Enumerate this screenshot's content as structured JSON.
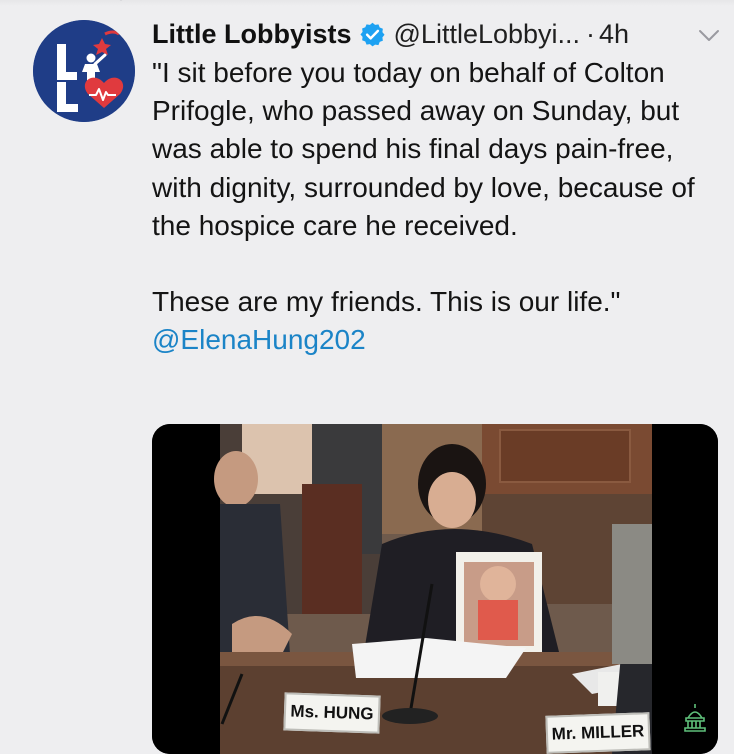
{
  "tweet": {
    "author_name": "Little Lobbyists",
    "handle": "@LittleLobbyi...",
    "separator": "·",
    "time": "4h",
    "avatar_icon": "little-lobbyists-logo-icon",
    "verified_icon": "verified-badge-icon",
    "menu_icon": "chevron-down-icon",
    "text_paragraph_1": "\"I sit before you today on behalf of Colton Prifogle, who passed away on Sunday, but was able to spend his final days pain-free, with dignity, surrounded by love, because of the hospice care he received.",
    "text_paragraph_2": "These are my friends. This is our life.\"",
    "mention": "@ElenaHung202"
  },
  "media": {
    "nameplate_left": "Ms. HUNG",
    "nameplate_right": "Mr. MILLER",
    "watermark_icon": "capitol-dome-icon"
  },
  "colors": {
    "background": "#eeeef0",
    "link": "#1b84c7",
    "verified": "#1da1f2",
    "avatar": "#1f3d87"
  }
}
